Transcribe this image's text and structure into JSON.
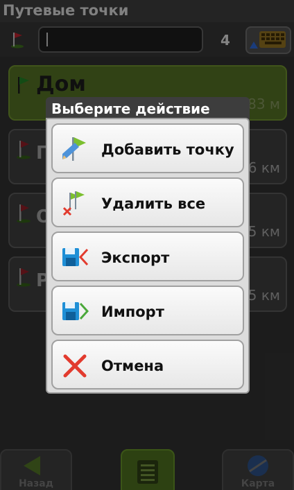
{
  "header": {
    "title": "Путевые точки"
  },
  "search": {
    "count": "4"
  },
  "list": [
    {
      "label": "Дом",
      "distance": "83 м"
    },
    {
      "label": "Г",
      "distance": "6 км"
    },
    {
      "label": "О",
      "distance": "5 км"
    },
    {
      "label": "Р",
      "distance": "5 км"
    }
  ],
  "dialog": {
    "title": "Выберите действие",
    "options": [
      {
        "label": "Добавить точку",
        "icon": "add-point-icon"
      },
      {
        "label": "Удалить все",
        "icon": "delete-all-icon"
      },
      {
        "label": "Экспорт",
        "icon": "export-icon"
      },
      {
        "label": "Импорт",
        "icon": "import-icon"
      },
      {
        "label": "Отмена",
        "icon": "cancel-icon"
      }
    ]
  },
  "bottom": {
    "back_label": "Назад",
    "map_label": "Карта"
  },
  "colors": {
    "home_row": "#4f6b22",
    "accent_green": "#7bbf2f",
    "dialog_bg": "#dcdcdc"
  }
}
